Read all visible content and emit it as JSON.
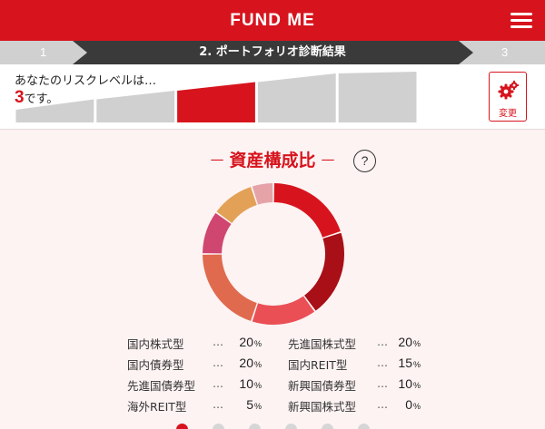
{
  "header": {
    "title": "FUND ME",
    "menu_icon": "hamburger-menu-icon"
  },
  "steps": {
    "prev": "1",
    "current": "2. ポートフォリオ診断結果",
    "next": "3"
  },
  "risk": {
    "text": "あなたのリスクレベルは…",
    "level": "3",
    "suffix": "です。",
    "level_value": 3,
    "level_count": 5,
    "active_color": "#d7141d",
    "inactive_color": "#d0d0d0"
  },
  "change_button": {
    "label": "変更",
    "icon": "gears-icon"
  },
  "section": {
    "title": "資産構成比",
    "dash": "—",
    "help_label": "?"
  },
  "chart_data": {
    "type": "pie",
    "categories": [
      "国内株式型",
      "先進国株式型",
      "国内REIT型",
      "国内債券型",
      "先進国債券型",
      "新興国債券型",
      "海外REIT型",
      "新興国株式型"
    ],
    "values": [
      20,
      20,
      15,
      20,
      10,
      10,
      5,
      0
    ],
    "colors": [
      "#d7141d",
      "#a80f16",
      "#ea4f55",
      "#e06a4e",
      "#cf4670",
      "#e2a156",
      "#e5a3a8",
      "#cccccc"
    ]
  },
  "legend": [
    {
      "label": "国内株式型",
      "dots": "…",
      "value": "20",
      "unit": "%"
    },
    {
      "label": "先進国株式型",
      "dots": "…",
      "value": "20",
      "unit": "%"
    },
    {
      "label": "国内債券型",
      "dots": "…",
      "value": "20",
      "unit": "%"
    },
    {
      "label": "国内REIT型",
      "dots": "…",
      "value": "15",
      "unit": "%"
    },
    {
      "label": "先進国債券型",
      "dots": "…",
      "value": "10",
      "unit": "%"
    },
    {
      "label": "新興国債券型",
      "dots": "…",
      "value": "10",
      "unit": "%"
    },
    {
      "label": "海外REIT型",
      "dots": "…",
      "value": "5",
      "unit": "%"
    },
    {
      "label": "新興国株式型",
      "dots": "…",
      "value": "0",
      "unit": "%"
    }
  ],
  "pager": {
    "count": 6,
    "active": 0
  }
}
